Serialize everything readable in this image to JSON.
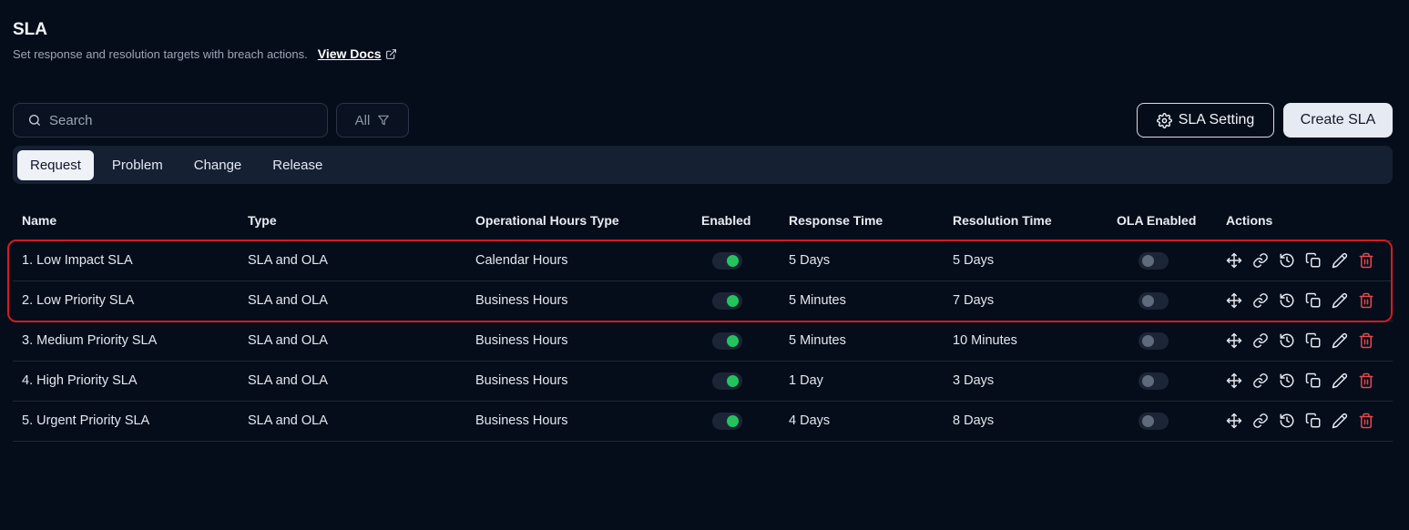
{
  "header": {
    "title": "SLA",
    "subtitle": "Set response and resolution targets with breach actions.",
    "docs_link": "View Docs"
  },
  "toolbar": {
    "search_placeholder": "Search",
    "filter_label": "All",
    "setting_label": "SLA Setting",
    "create_label": "Create SLA"
  },
  "tabs": [
    {
      "label": "Request",
      "active": true
    },
    {
      "label": "Problem",
      "active": false
    },
    {
      "label": "Change",
      "active": false
    },
    {
      "label": "Release",
      "active": false
    }
  ],
  "table": {
    "headers": {
      "name": "Name",
      "type": "Type",
      "hours": "Operational Hours Type",
      "enabled": "Enabled",
      "response": "Response Time",
      "resolution": "Resolution Time",
      "ola": "OLA Enabled",
      "actions": "Actions"
    },
    "rows": [
      {
        "name": "1. Low Impact SLA",
        "type": "SLA and OLA",
        "hours": "Calendar Hours",
        "enabled": true,
        "response": "5 Days",
        "resolution": "5 Days",
        "ola": false
      },
      {
        "name": "2. Low Priority SLA",
        "type": "SLA and OLA",
        "hours": "Business Hours",
        "enabled": true,
        "response": "5 Minutes",
        "resolution": "7 Days",
        "ola": false
      },
      {
        "name": "3. Medium Priority SLA",
        "type": "SLA and OLA",
        "hours": "Business Hours",
        "enabled": true,
        "response": "5 Minutes",
        "resolution": "10 Minutes",
        "ola": false
      },
      {
        "name": "4. High Priority SLA",
        "type": "SLA and OLA",
        "hours": "Business Hours",
        "enabled": true,
        "response": "1 Day",
        "resolution": "3 Days",
        "ola": false
      },
      {
        "name": "5. Urgent Priority SLA",
        "type": "SLA and OLA",
        "hours": "Business Hours",
        "enabled": true,
        "response": "4 Days",
        "resolution": "8 Days",
        "ola": false
      }
    ]
  },
  "icons": {
    "actions": [
      "move-icon",
      "link-icon",
      "history-icon",
      "duplicate-icon",
      "edit-icon",
      "delete-icon"
    ]
  },
  "colors": {
    "accent_green": "#23c45e",
    "danger_red": "#e5484d",
    "highlight_red": "#d21c22"
  }
}
